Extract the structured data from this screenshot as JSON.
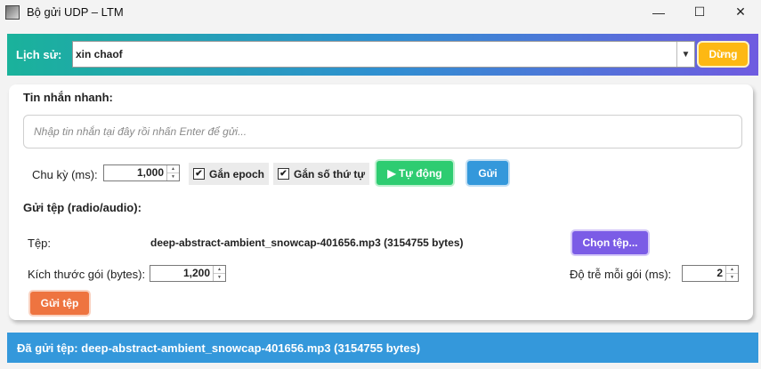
{
  "window": {
    "title": "Bộ gửi UDP – LTM",
    "minimize": "—",
    "maximize": "☐",
    "close": "✕"
  },
  "history": {
    "label": "Lịch sử:",
    "value": "xin chaof",
    "stop_label": "Dừng"
  },
  "quick": {
    "title": "Tin nhắn nhanh:",
    "placeholder": "Nhập tin nhắn tại đây rồi nhấn Enter để gửi...",
    "period_label": "Chu kỳ (ms):",
    "period_value": "1,000",
    "epoch_label": "Gắn epoch",
    "epoch_checked": true,
    "seq_label": "Gắn số thứ tự",
    "seq_checked": true,
    "auto_label": "▶ Tự động",
    "send_label": "Gửi"
  },
  "file": {
    "title": "Gửi tệp (radio/audio):",
    "file_label": "Tệp:",
    "file_name": "deep-abstract-ambient_snowcap-401656.mp3 (3154755 bytes)",
    "choose_label": "Chọn tệp...",
    "packet_size_label": "Kích thước gói (bytes):",
    "packet_size_value": "1,200",
    "delay_label": "Độ trễ mỗi gói (ms):",
    "delay_value": "2",
    "send_file_label": "Gửi tệp"
  },
  "status": {
    "text": "Đã gửi tệp: deep-abstract-ambient_snowcap-401656.mp3 (3154755 bytes)"
  }
}
